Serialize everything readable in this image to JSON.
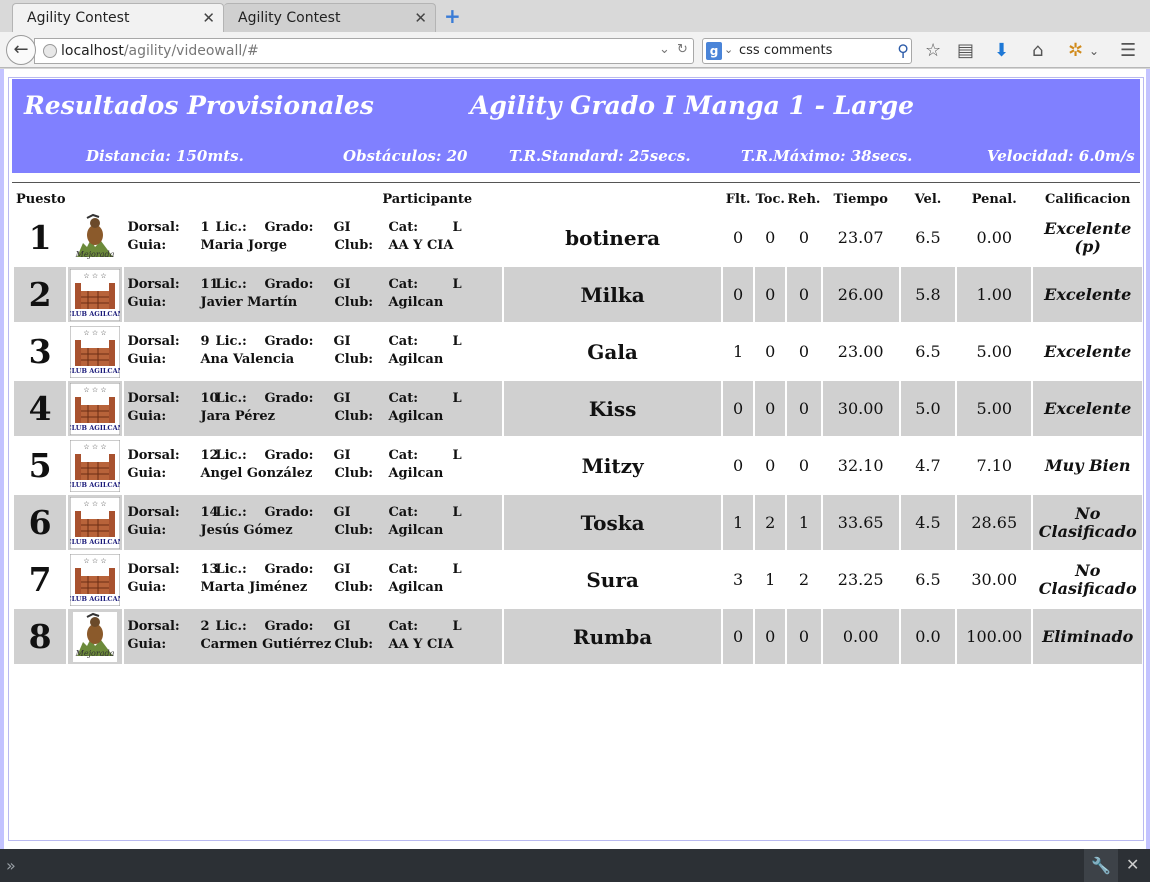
{
  "browser": {
    "tabs": [
      {
        "label": "Agility Contest"
      },
      {
        "label": "Agility Contest"
      }
    ],
    "url_host": "localhost",
    "url_path": "/agility/videowall/#",
    "search_value": "css comments",
    "search_engine_icon": "google-icon"
  },
  "banner": {
    "title_left": "Resultados Provisionales",
    "title_right": "Agility Grado I Manga 1 - Large",
    "distancia": "Distancia: 150mts.",
    "obstaculos": "Obstáculos: 20",
    "trs": "T.R.Standard: 25secs.",
    "trm": "T.R.Máximo: 38secs.",
    "velocidad": "Velocidad: 6.0m/s"
  },
  "table": {
    "headers": {
      "puesto": "Puesto",
      "participante": "Participante",
      "flt": "Flt.",
      "toc": "Toc.",
      "reh": "Reh.",
      "tiempo": "Tiempo",
      "vel": "Vel.",
      "penal": "Penal.",
      "calif": "Calificacion"
    },
    "labels": {
      "dorsal": "Dorsal:",
      "lic": "Lic.:",
      "grado": "Grado:",
      "cat": "Cat:",
      "guia": "Guia:",
      "club": "Club:"
    },
    "rows": [
      {
        "puesto": "1",
        "logo": "mejorada",
        "dorsal": "1",
        "grado": "GI",
        "cat": "L",
        "guia": "Maria Jorge",
        "club": "AA Y CIA",
        "perro": "botinera",
        "flt": "0",
        "toc": "0",
        "reh": "0",
        "tiempo": "23.07",
        "vel": "6.5",
        "penal": "0.00",
        "calif": "Excelente (p)"
      },
      {
        "puesto": "2",
        "logo": "agilcan",
        "dorsal": "11",
        "grado": "GI",
        "cat": "L",
        "guia": "Javier Martín",
        "club": "Agilcan",
        "perro": "Milka",
        "flt": "0",
        "toc": "0",
        "reh": "0",
        "tiempo": "26.00",
        "vel": "5.8",
        "penal": "1.00",
        "calif": "Excelente"
      },
      {
        "puesto": "3",
        "logo": "agilcan",
        "dorsal": "9",
        "grado": "GI",
        "cat": "L",
        "guia": "Ana Valencia",
        "club": "Agilcan",
        "perro": "Gala",
        "flt": "1",
        "toc": "0",
        "reh": "0",
        "tiempo": "23.00",
        "vel": "6.5",
        "penal": "5.00",
        "calif": "Excelente"
      },
      {
        "puesto": "4",
        "logo": "agilcan",
        "dorsal": "10",
        "grado": "GI",
        "cat": "L",
        "guia": "Jara Pérez",
        "club": "Agilcan",
        "perro": "Kiss",
        "flt": "0",
        "toc": "0",
        "reh": "0",
        "tiempo": "30.00",
        "vel": "5.0",
        "penal": "5.00",
        "calif": "Excelente"
      },
      {
        "puesto": "5",
        "logo": "agilcan",
        "dorsal": "12",
        "grado": "GI",
        "cat": "L",
        "guia": "Angel González",
        "club": "Agilcan",
        "perro": "Mitzy",
        "flt": "0",
        "toc": "0",
        "reh": "0",
        "tiempo": "32.10",
        "vel": "4.7",
        "penal": "7.10",
        "calif": "Muy Bien"
      },
      {
        "puesto": "6",
        "logo": "agilcan",
        "dorsal": "14",
        "grado": "GI",
        "cat": "L",
        "guia": "Jesús Gómez",
        "club": "Agilcan",
        "perro": "Toska",
        "flt": "1",
        "toc": "2",
        "reh": "1",
        "tiempo": "33.65",
        "vel": "4.5",
        "penal": "28.65",
        "calif": "No Clasificado"
      },
      {
        "puesto": "7",
        "logo": "agilcan",
        "dorsal": "13",
        "grado": "GI",
        "cat": "L",
        "guia": "Marta Jiménez",
        "club": "Agilcan",
        "perro": "Sura",
        "flt": "3",
        "toc": "1",
        "reh": "2",
        "tiempo": "23.25",
        "vel": "6.5",
        "penal": "30.00",
        "calif": "No Clasificado"
      },
      {
        "puesto": "8",
        "logo": "mejorada",
        "dorsal": "2",
        "grado": "GI",
        "cat": "L",
        "guia": "Carmen Gutiérrez",
        "club": "AA Y CIA",
        "perro": "Rumba",
        "flt": "0",
        "toc": "0",
        "reh": "0",
        "tiempo": "0.00",
        "vel": "0.0",
        "penal": "100.00",
        "calif": "Eliminado"
      }
    ]
  }
}
